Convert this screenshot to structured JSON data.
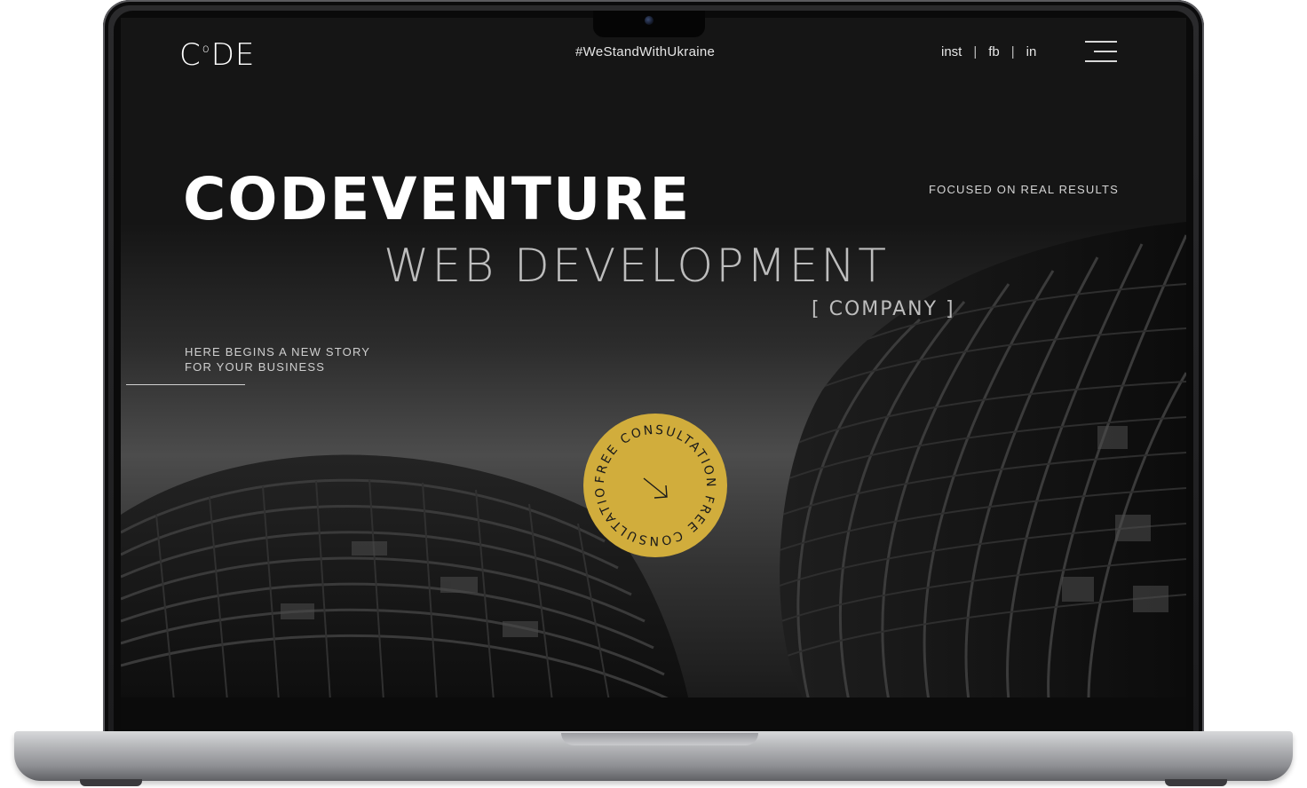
{
  "header": {
    "logo_prefix": "C",
    "logo_mark": "o",
    "logo_suffix": "DE",
    "hashtag": "#WeStandWithUkraine",
    "social": [
      "inst",
      "fb",
      "in"
    ],
    "menu_icon": "hamburger-menu-icon"
  },
  "hero": {
    "title": "CODEVENTURE",
    "subtitle": "WEB DEVELOPMENT",
    "tag": "[ COMPANY ]",
    "focused": "FOCUSED ON REAL RESULTS",
    "story_line1": "HERE BEGINS A NEW STORY",
    "story_line2": "FOR YOUR BUSINESS"
  },
  "cta": {
    "ring_text": "FREE CONSULTATION FREE CONSULTATION",
    "icon": "arrow-down-right-icon",
    "color": "#d1ad3c"
  },
  "colors": {
    "background": "#151515",
    "text": "#ffffff",
    "muted": "#bdbdbd",
    "accent": "#d1ad3c"
  }
}
